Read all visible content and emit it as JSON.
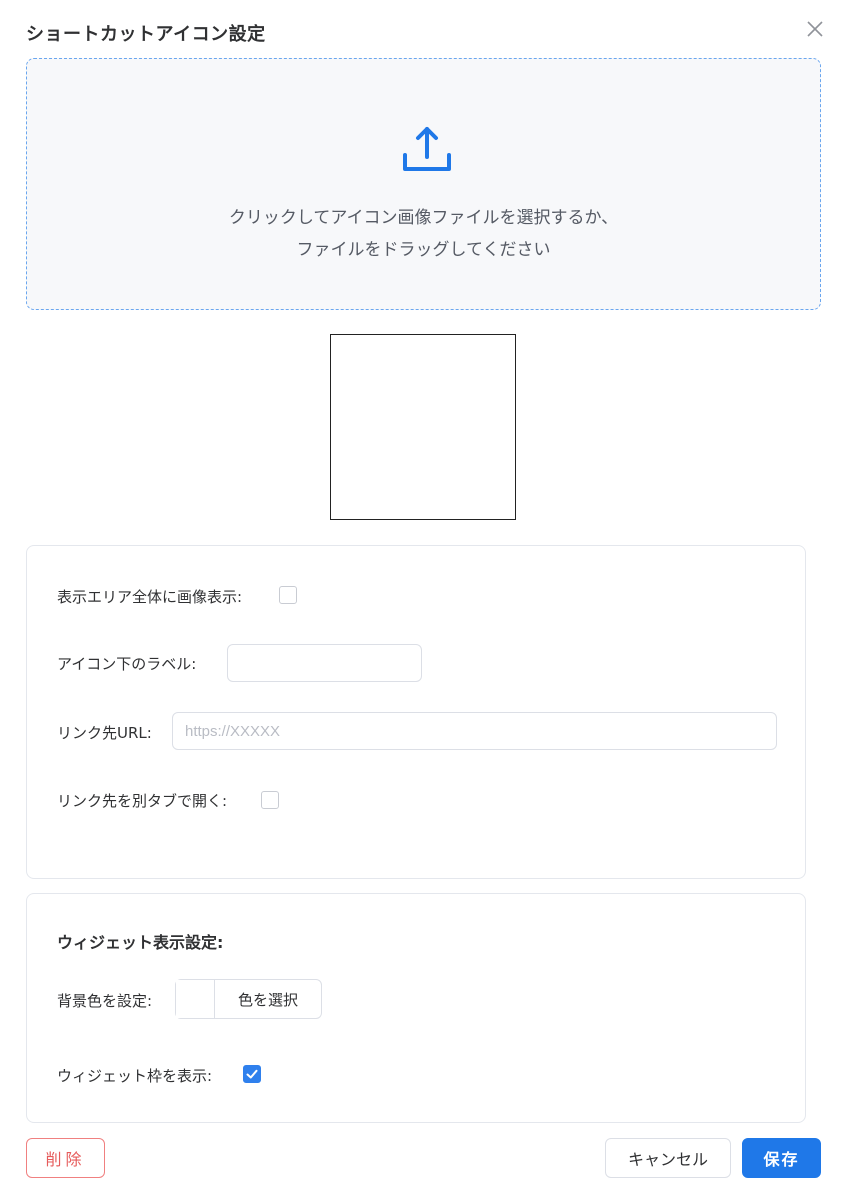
{
  "dialog": {
    "title": "ショートカットアイコン設定"
  },
  "upload": {
    "icon": "upload-icon",
    "line1": "クリックしてアイコン画像ファイルを選択するか、",
    "line2": "ファイルをドラッグしてください"
  },
  "form": {
    "full_image_label": "表示エリア全体に画像表示:",
    "full_image_checked": false,
    "icon_label_label": "アイコン下のラベル:",
    "icon_label_value": "",
    "link_url_label": "リンク先URL:",
    "link_url_placeholder": "https://XXXXX",
    "link_url_value": "",
    "new_tab_label": "リンク先を別タブで開く:",
    "new_tab_checked": false
  },
  "widget": {
    "section_title": "ウィジェット表示設定:",
    "bg_color_label": "背景色を設定:",
    "bg_color_value": "#ffffff",
    "choose_color_label": "色を選択",
    "show_border_label": "ウィジェット枠を表示:",
    "show_border_checked": true
  },
  "footer": {
    "delete_label": "削除",
    "cancel_label": "キャンセル",
    "save_label": "保存"
  },
  "colors": {
    "accent": "#1f78e8",
    "danger": "#e65b5b",
    "upload_border": "#6aa6ef"
  }
}
